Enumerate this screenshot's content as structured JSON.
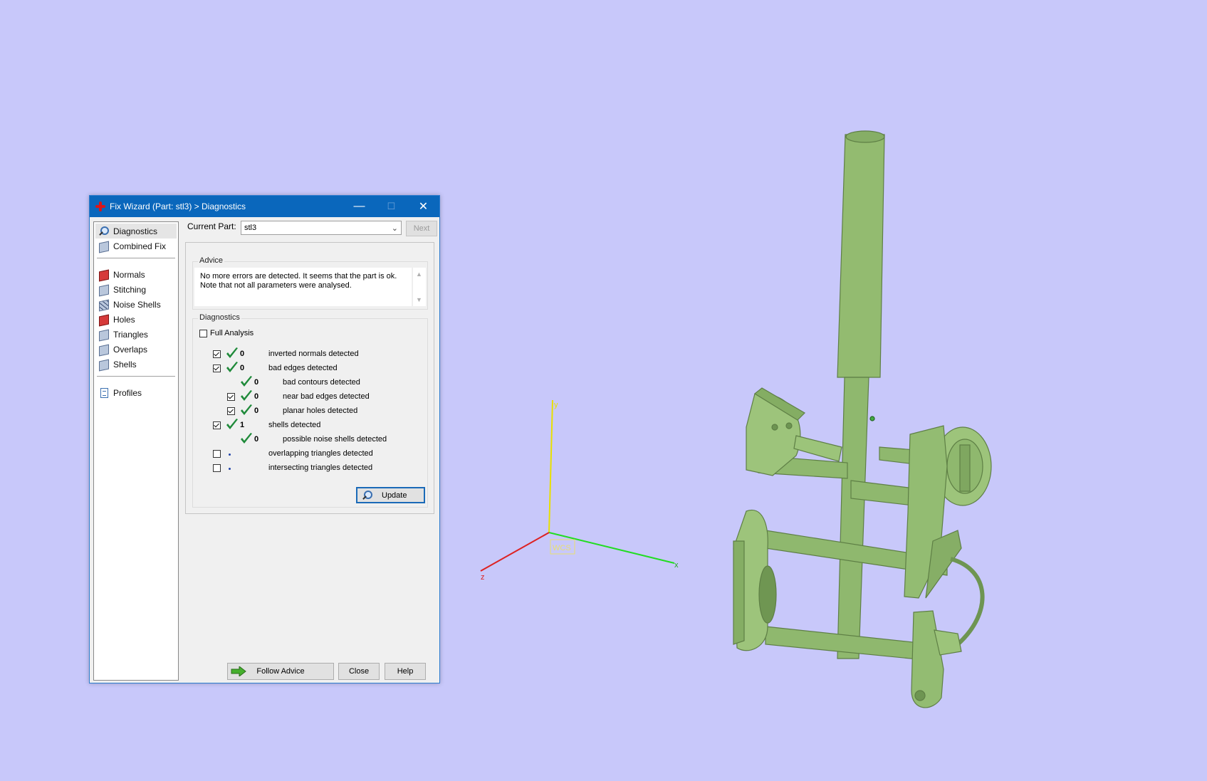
{
  "window": {
    "title": "Fix Wizard (Part: stl3) > Diagnostics",
    "min_glyph": "—",
    "max_glyph": "☐",
    "close_glyph": "✕"
  },
  "nav": {
    "items": [
      {
        "label": "Diagnostics",
        "icon": "magnifier-icon"
      },
      {
        "label": "Combined Fix",
        "icon": "cube-icon"
      },
      {
        "label": "Normals",
        "icon": "normals-cube-icon"
      },
      {
        "label": "Stitching",
        "icon": "cube-icon"
      },
      {
        "label": "Noise Shells",
        "icon": "noise-cube-icon"
      },
      {
        "label": "Holes",
        "icon": "holes-cube-icon"
      },
      {
        "label": "Triangles",
        "icon": "cube-icon"
      },
      {
        "label": "Overlaps",
        "icon": "cube-icon"
      },
      {
        "label": "Shells",
        "icon": "cube-icon"
      },
      {
        "label": "Profiles",
        "icon": "document-icon"
      }
    ]
  },
  "current_part": {
    "label": "Current Part:",
    "value": "stl3",
    "next_label": "Next"
  },
  "advice": {
    "title": "Advice",
    "line1": "No more errors are detected. It seems that the part is ok.",
    "line2": "Note that not all parameters were analysed."
  },
  "diagnostics": {
    "title": "Diagnostics",
    "full_analysis_label": "Full Analysis",
    "rows": [
      {
        "checked": true,
        "ok": true,
        "count": "0",
        "label": "inverted normals detected"
      },
      {
        "checked": true,
        "ok": true,
        "count": "0",
        "label": "bad edges detected"
      },
      {
        "checked": null,
        "ok": true,
        "count": "0",
        "label": "bad contours detected"
      },
      {
        "checked": true,
        "ok": true,
        "count": "0",
        "label": "near bad edges detected"
      },
      {
        "checked": true,
        "ok": true,
        "count": "0",
        "label": "planar holes detected"
      },
      {
        "checked": true,
        "ok": true,
        "count": "1",
        "label": "shells detected"
      },
      {
        "checked": null,
        "ok": true,
        "count": "0",
        "label": "possible noise shells detected"
      },
      {
        "checked": false,
        "ok": false,
        "count": "",
        "label": "overlapping triangles detected"
      },
      {
        "checked": false,
        "ok": false,
        "count": "",
        "label": "intersecting triangles detected"
      }
    ],
    "update_label": "Update"
  },
  "footer": {
    "follow_advice_label": "Follow Advice",
    "close_label": "Close",
    "help_label": "Help"
  },
  "viewport": {
    "axis_x": "x",
    "axis_y": "y",
    "axis_z": "z",
    "wcs_label": "WCS",
    "model_color": "#8fb86e",
    "background": "#c8c8fa"
  }
}
